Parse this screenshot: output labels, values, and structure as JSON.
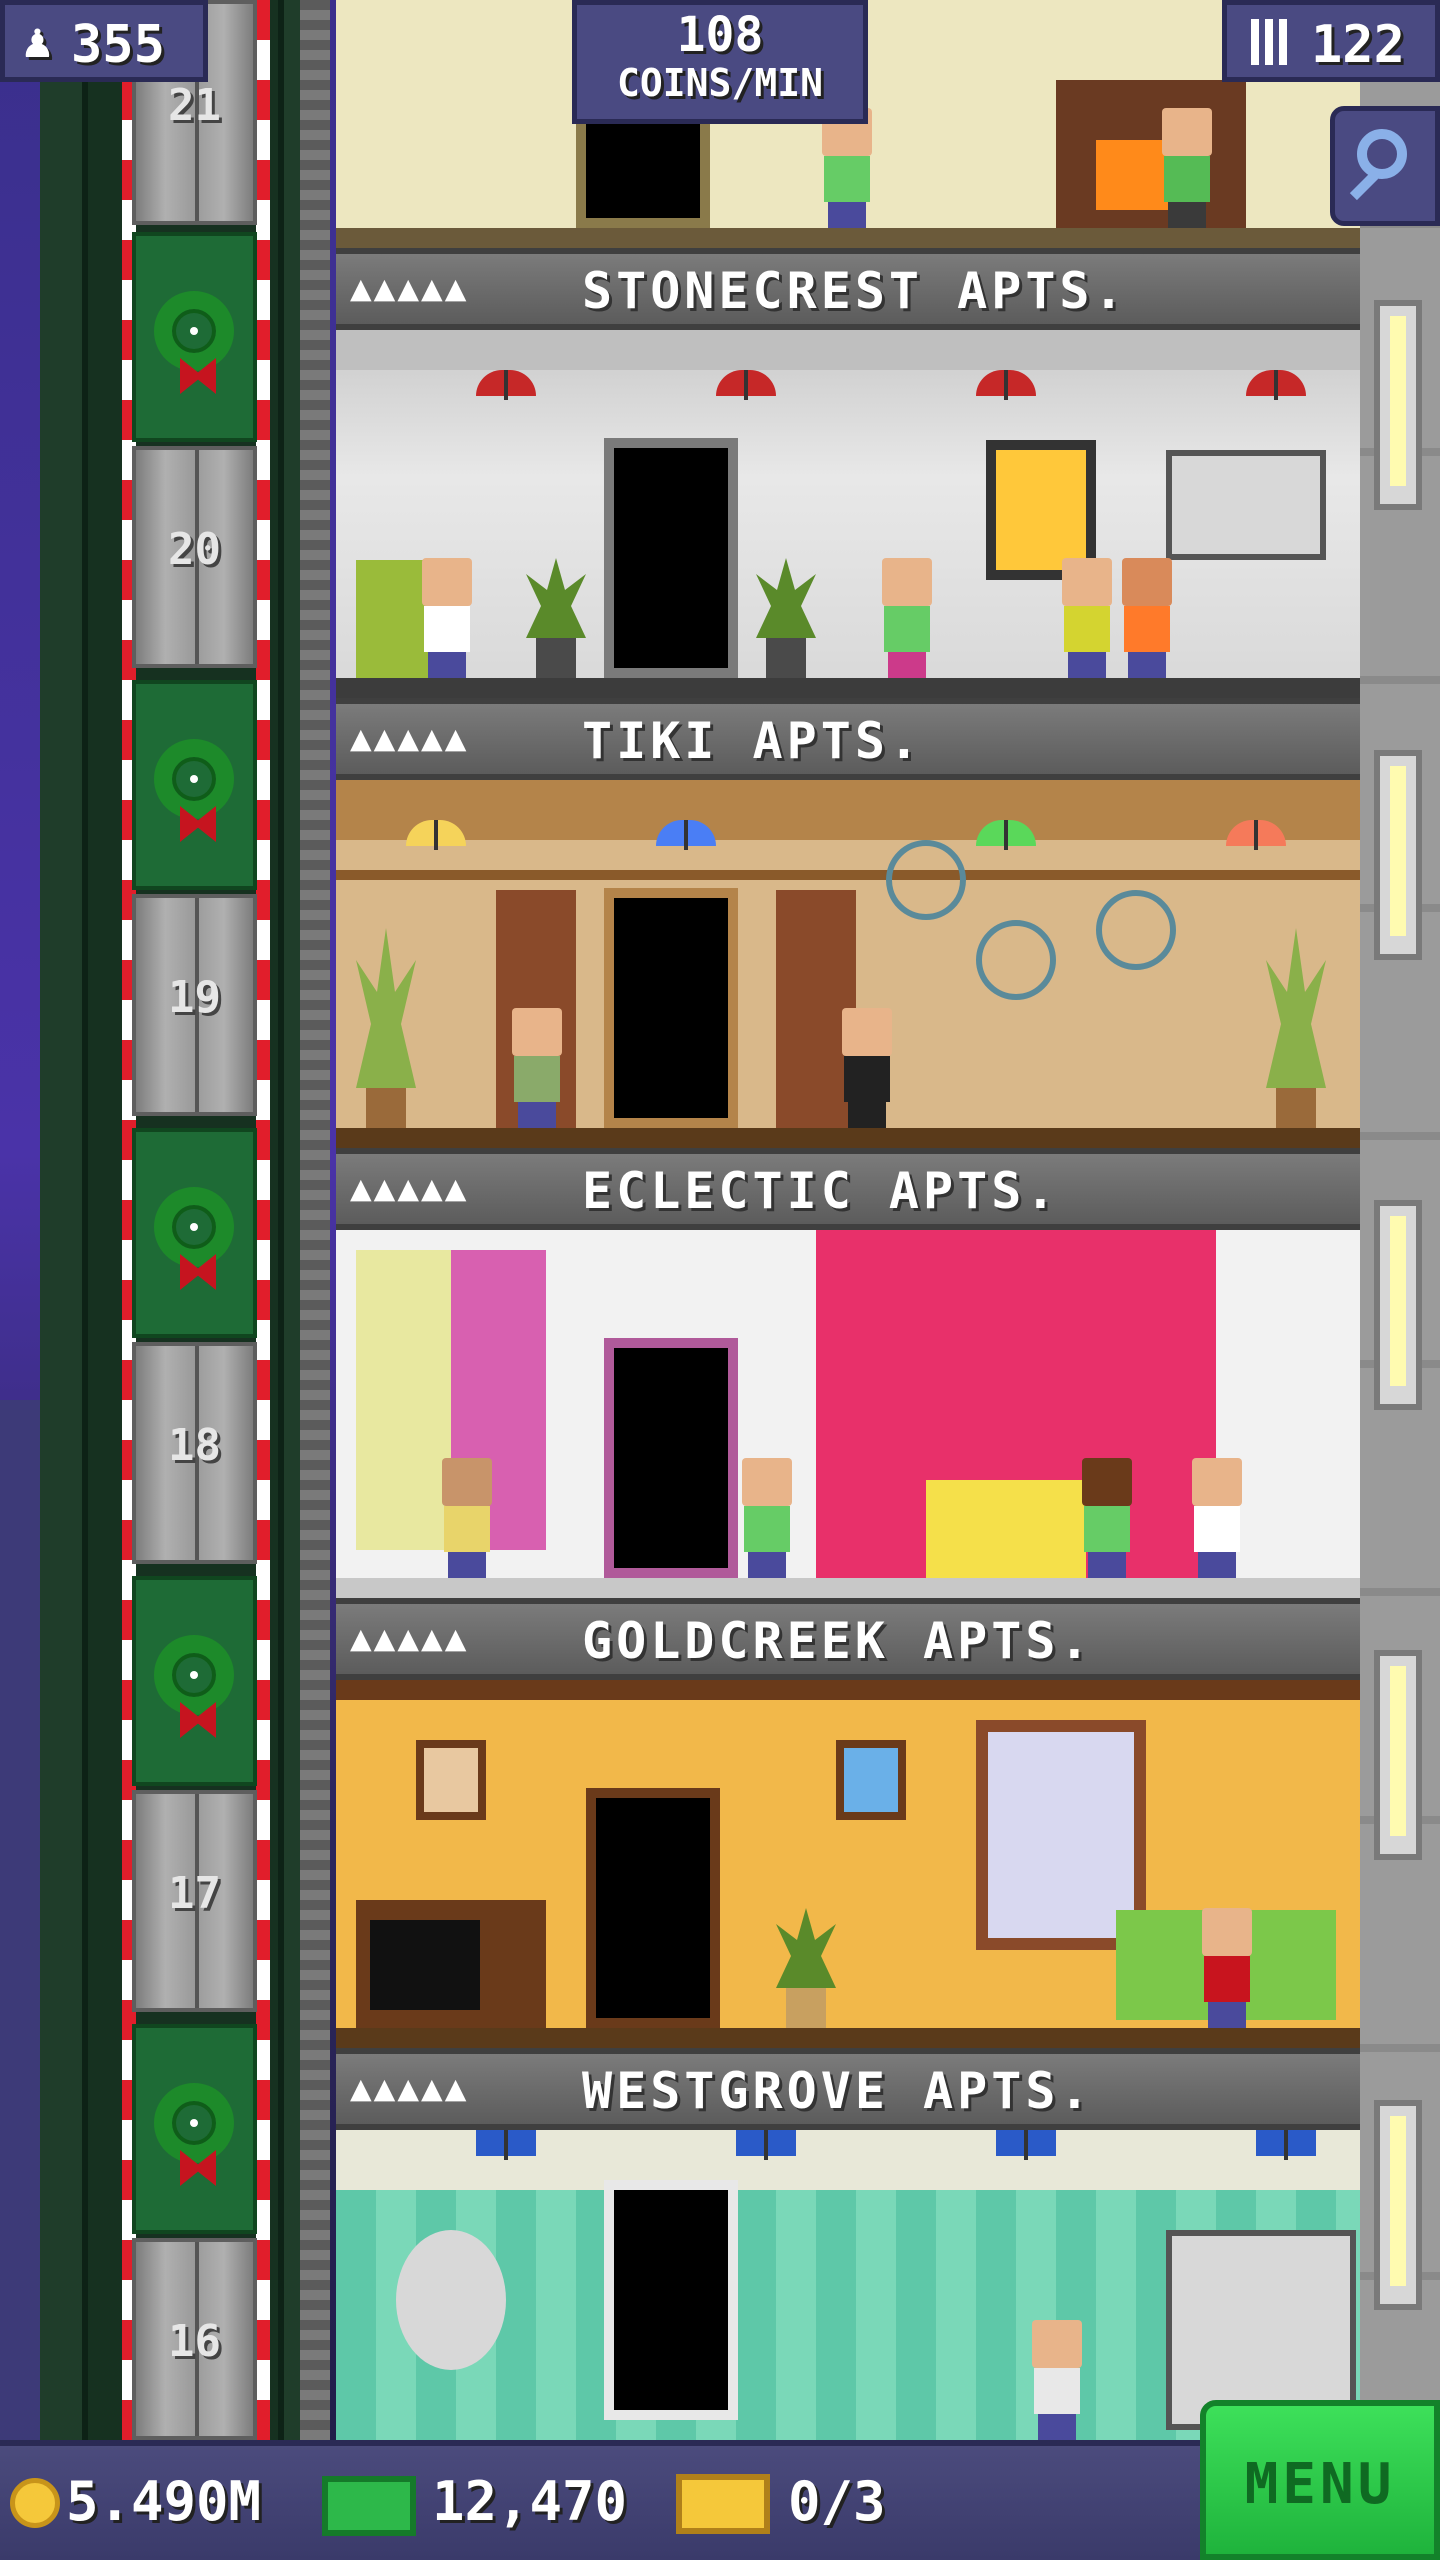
{
  "hud": {
    "population": "355",
    "coins_rate_value": "108",
    "coins_rate_unit": "COINS/MIN",
    "floor_count": "122"
  },
  "bottom_bar": {
    "coins": "5.490M",
    "bux": "12,470",
    "vip": "0/3",
    "menu_label": "MENU"
  },
  "floors": [
    {
      "number": "21",
      "name": "STONECREST APTS.",
      "stars": "▲▲▲▲▲"
    },
    {
      "number": "20",
      "name": "TIKI APTS.",
      "stars": "▲▲▲▲▲"
    },
    {
      "number": "19",
      "name": "ECLECTIC APTS.",
      "stars": "▲▲▲▲▲"
    },
    {
      "number": "18",
      "name": "GOLDCREEK APTS.",
      "stars": "▲▲▲▲▲"
    },
    {
      "number": "17",
      "name": "WESTGROVE APTS.",
      "stars": "▲▲▲▲▲"
    },
    {
      "number": "16",
      "name": "",
      "stars": ""
    }
  ],
  "icons": {
    "population": "person-icon",
    "floors": "building-icon",
    "zoom": "magnifier-icon",
    "coin": "coin-icon",
    "bux": "bux-icon",
    "vip": "ticket-icon"
  },
  "colors": {
    "menu": "#1fb33c",
    "rail_red": "#e11e2b",
    "hud": "#4a4a82"
  }
}
